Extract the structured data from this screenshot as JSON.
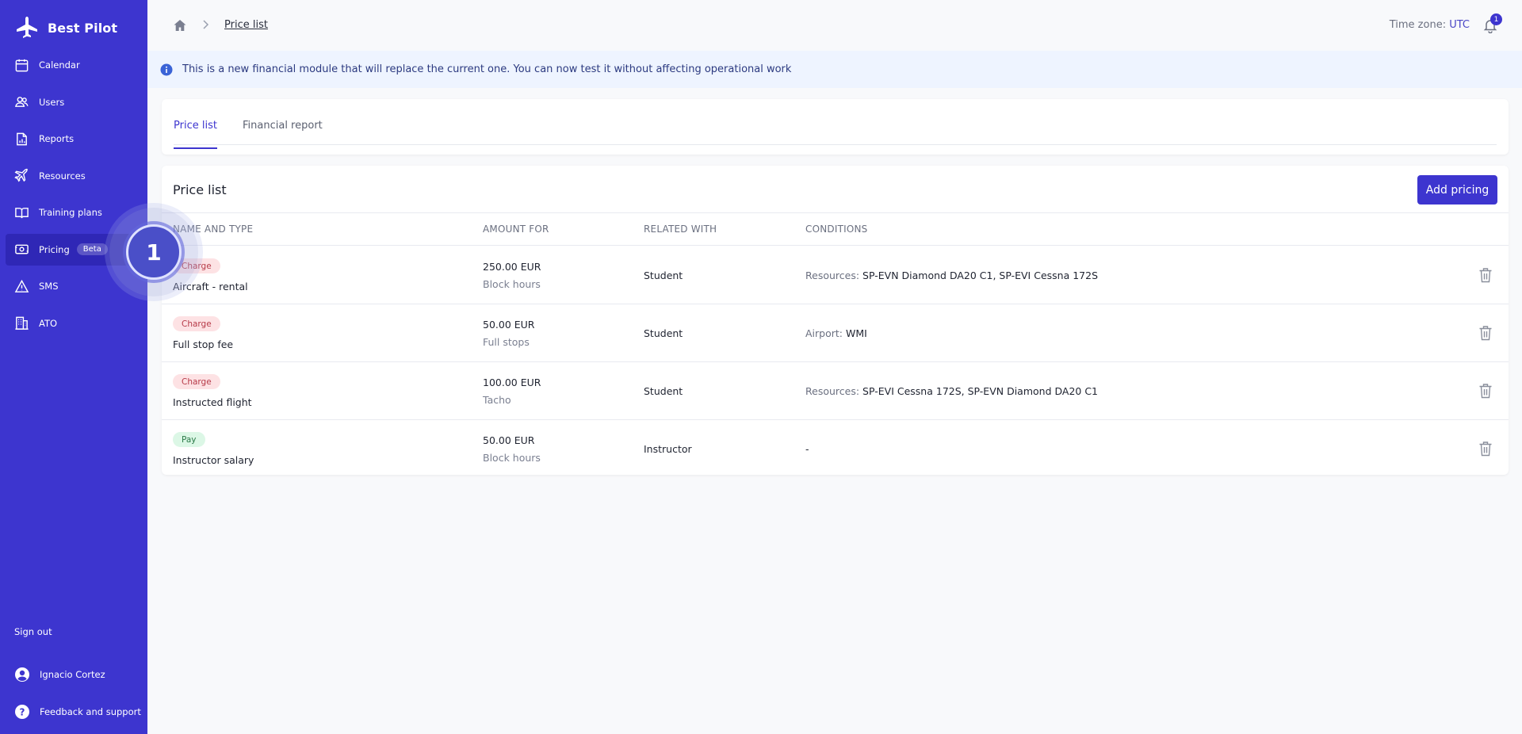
{
  "app": {
    "name": "Best Pilot"
  },
  "sidebar": {
    "items": [
      {
        "label": "Calendar",
        "icon": "calendar-icon",
        "active": false
      },
      {
        "label": "Users",
        "icon": "users-icon",
        "active": false
      },
      {
        "label": "Reports",
        "icon": "reports-icon",
        "active": false
      },
      {
        "label": "Resources",
        "icon": "plane-icon",
        "active": false
      },
      {
        "label": "Training plans",
        "icon": "book-icon",
        "active": false
      },
      {
        "label": "Pricing",
        "icon": "pricing-icon",
        "active": true,
        "badge": "Beta"
      },
      {
        "label": "SMS",
        "icon": "warning-icon",
        "active": false
      },
      {
        "label": "ATO",
        "icon": "building-icon",
        "active": false
      }
    ],
    "sign_out": "Sign out",
    "user_name": "Ignacio Cortez",
    "feedback": "Feedback and support"
  },
  "tutorial": {
    "step": "1"
  },
  "topbar": {
    "breadcrumb_current": "Price list",
    "timezone_label": "Time zone:",
    "timezone_value": "UTC",
    "notification_count": "1"
  },
  "banner": {
    "text": "This is a new financial module that will replace the current one. You can now test it without affecting operational work"
  },
  "tabs": [
    {
      "label": "Price list",
      "active": true
    },
    {
      "label": "Financial report",
      "active": false
    }
  ],
  "price_list": {
    "title": "Price list",
    "add_button": "Add pricing",
    "columns": [
      "NAME AND TYPE",
      "AMOUNT FOR",
      "RELATED WITH",
      "CONDITIONS"
    ],
    "rows": [
      {
        "type": "Charge",
        "name": "Aircraft - rental",
        "amount": "250.00 EUR",
        "unit": "Block hours",
        "related": "Student",
        "cond_key": "Resources:",
        "cond_val": "SP-EVN Diamond DA20 C1, SP-EVI Cessna 172S"
      },
      {
        "type": "Charge",
        "name": "Full stop fee",
        "amount": "50.00 EUR",
        "unit": "Full stops",
        "related": "Student",
        "cond_key": "Airport:",
        "cond_val": "WMI"
      },
      {
        "type": "Charge",
        "name": "Instructed flight",
        "amount": "100.00 EUR",
        "unit": "Tacho",
        "related": "Student",
        "cond_key": "Resources:",
        "cond_val": "SP-EVI Cessna 172S, SP-EVN Diamond DA20 C1"
      },
      {
        "type": "Pay",
        "name": "Instructor salary",
        "amount": "50.00 EUR",
        "unit": "Block hours",
        "related": "Instructor",
        "cond_key": "",
        "cond_val": "-"
      }
    ]
  },
  "colors": {
    "sidebar": "#3d35cf",
    "accent": "#3d35cf",
    "charge": "#fde2e4",
    "pay": "#dcf7e6",
    "banner": "#eef4ff"
  }
}
